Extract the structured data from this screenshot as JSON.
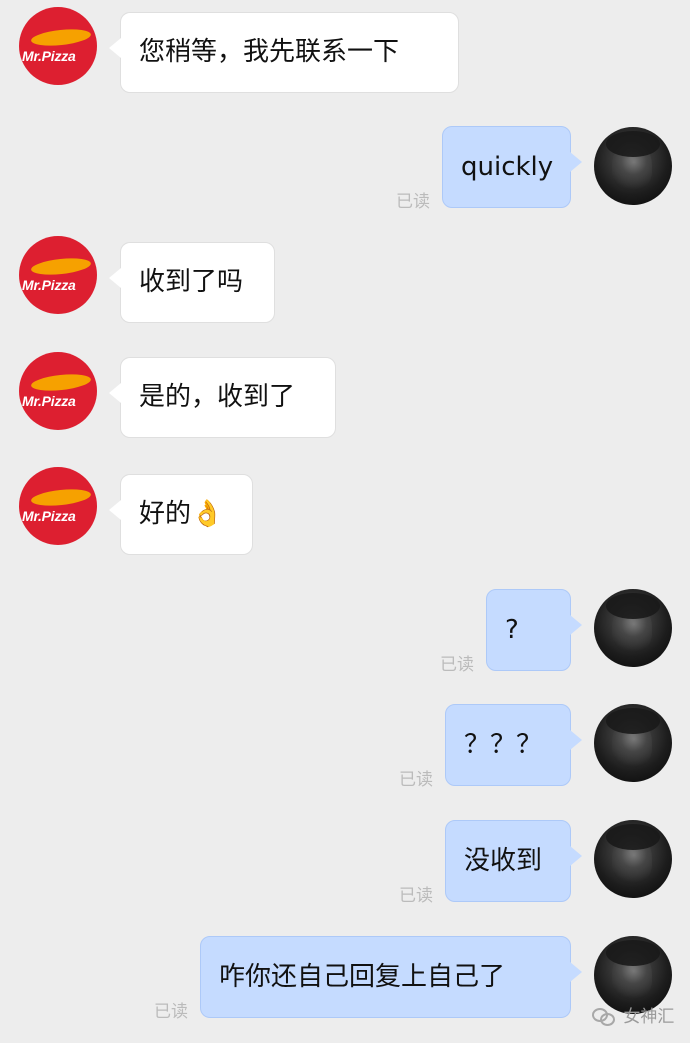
{
  "chat": {
    "messages": [
      {
        "sender": "Mr. Pizza",
        "direction": "in",
        "text": "您稍等，我先联系一下",
        "avatar_text": "Mr.Pizza"
      },
      {
        "sender": "user",
        "direction": "out",
        "text": "quickly",
        "read_label": "已读"
      },
      {
        "sender": "Mr. Pizza",
        "direction": "in",
        "text": "收到了吗",
        "avatar_text": "Mr.Pizza"
      },
      {
        "sender": "Mr. Pizza",
        "direction": "in",
        "text": "是的，收到了",
        "avatar_text": "Mr.Pizza"
      },
      {
        "sender": "Mr. Pizza",
        "direction": "in",
        "text": "好的👌",
        "avatar_text": "Mr.Pizza"
      },
      {
        "sender": "user",
        "direction": "out",
        "text": "?",
        "read_label": "已读"
      },
      {
        "sender": "user",
        "direction": "out",
        "text": "？？？",
        "read_label": "已读"
      },
      {
        "sender": "user",
        "direction": "out",
        "text": "没收到",
        "read_label": "已读"
      },
      {
        "sender": "user",
        "direction": "out",
        "text": "咋你还自己回复上自己了",
        "read_label": "已读"
      }
    ]
  },
  "watermark": {
    "text": "女神汇",
    "icon": "wechat-icon"
  },
  "colors": {
    "background": "#ededed",
    "incoming_bubble": "#ffffff",
    "outgoing_bubble": "#c5dbff",
    "brand_red": "#dd1f30",
    "brand_orange": "#f6a100",
    "read_label": "#bbbbbb"
  }
}
